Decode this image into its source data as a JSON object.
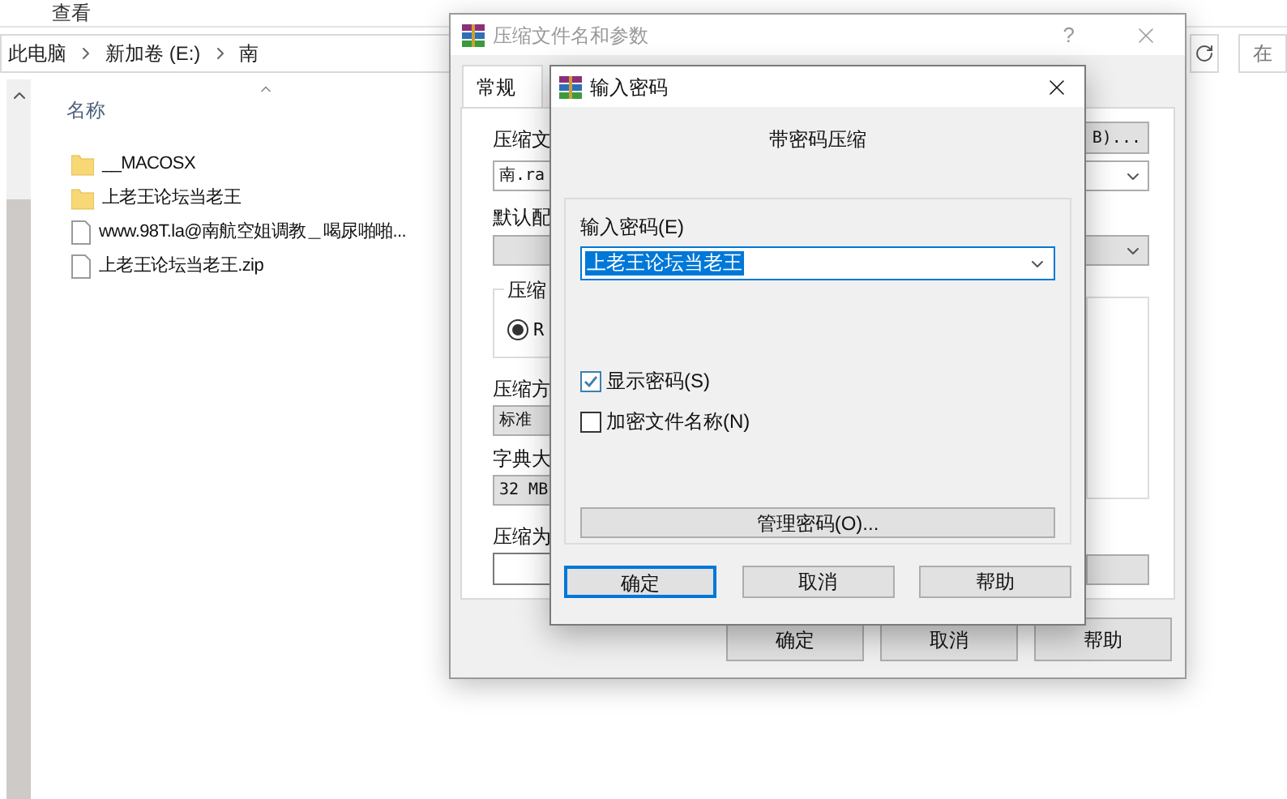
{
  "explorer": {
    "menu": [
      {
        "label": "查看"
      }
    ],
    "breadcrumb": [
      "此电脑",
      "新加卷 (E:)",
      "南"
    ],
    "search": {
      "placeholder": "在"
    },
    "column_header": "名称",
    "files": [
      {
        "name": "__MACOSX",
        "kind": "folder"
      },
      {
        "name": "上老王论坛当老王",
        "kind": "folder"
      },
      {
        "name": "www.98T.la@南航空姐调教＿喝尿啪啪...",
        "kind": "file"
      },
      {
        "name": "上老王论坛当老王.zip",
        "kind": "file"
      }
    ]
  },
  "archive_dialog": {
    "title": "压缩文件名和参数",
    "help": "?",
    "tabs": [
      {
        "label": "常规",
        "selected": true
      }
    ],
    "archive_name_label": "压缩文",
    "archive_name_value": "南.ra",
    "browse_button": "B)...",
    "profiles_label": "默认配",
    "format_group_label": "压缩",
    "format_radio": {
      "label": "R",
      "selected": true
    },
    "method_label": "压缩方",
    "method_value": "标准",
    "dictionary_label": "字典大",
    "dictionary_value": "32 MB",
    "split_label": "压缩为",
    "buttons": [
      {
        "label": "确定"
      },
      {
        "label": "取消"
      },
      {
        "label": "帮助"
      }
    ]
  },
  "password_dialog": {
    "title": "输入密码",
    "heading": "带密码压缩",
    "password_label": "输入密码(E)",
    "password_value": "上老王论坛当老王",
    "checkboxes": [
      {
        "label": "显示密码(S)",
        "checked": true
      },
      {
        "label": "加密文件名称(N)",
        "checked": false
      }
    ],
    "manage_button": "管理密码(O)...",
    "buttons": [
      {
        "label": "确定",
        "default": true
      },
      {
        "label": "取消",
        "default": false
      },
      {
        "label": "帮助",
        "default": false
      }
    ]
  }
}
